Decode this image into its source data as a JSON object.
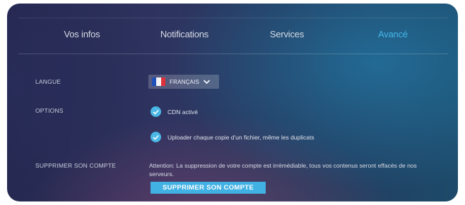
{
  "tabs": [
    {
      "label": "Vos infos",
      "active": false
    },
    {
      "label": "Notifications",
      "active": false
    },
    {
      "label": "Services",
      "active": false
    },
    {
      "label": "Avancé",
      "active": true
    }
  ],
  "language": {
    "label": "LANGUE",
    "selected": "FRANÇAIS",
    "flag_icon": "france-flag-icon"
  },
  "options": {
    "label": "OPTIONS",
    "items": [
      {
        "label": "CDN activé",
        "checked": true
      },
      {
        "label": "Uploader chaque copie d'un fichier, même les duplicats",
        "checked": true
      }
    ]
  },
  "delete_account": {
    "label": "SUPPRIMER SON COMPTE",
    "warning": "Attention: La suppression de votre compte est irrémédiable, tous vos contenus seront effacés de nos serveurs.",
    "button_label": "SUPPRIMER SON COMPTE"
  },
  "colors": {
    "accent": "#45b6e8",
    "button": "#41b1e3"
  }
}
